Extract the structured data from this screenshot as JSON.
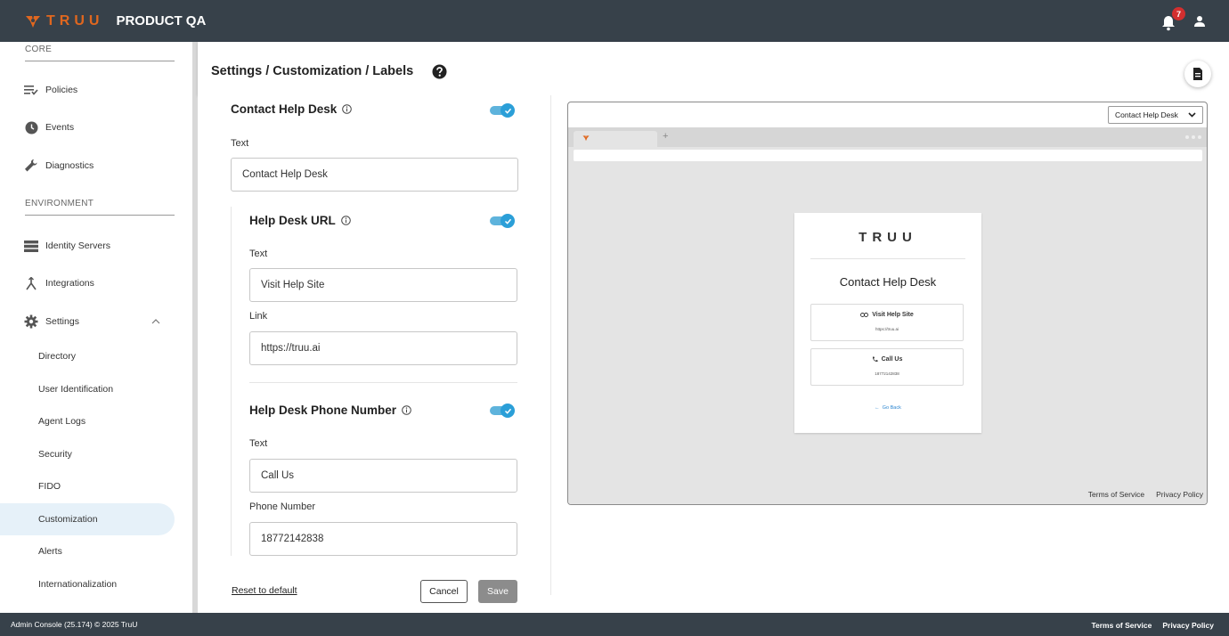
{
  "app": {
    "logo_text": "TRUU",
    "title": "PRODUCT QA",
    "notification_count": "7",
    "brand_color": "#e0671f",
    "topbar_color": "#37414a"
  },
  "sidebar": {
    "section_core": "CORE",
    "section_environment": "ENVIRONMENT",
    "items": {
      "policies": "Policies",
      "events": "Events",
      "diagnostics": "Diagnostics",
      "identity_servers": "Identity Servers",
      "integrations": "Integrations",
      "settings": "Settings"
    },
    "settings_children": {
      "directory": "Directory",
      "user_identification": "User Identification",
      "agent_logs": "Agent Logs",
      "security": "Security",
      "fido": "FIDO",
      "customization": "Customization",
      "alerts": "Alerts",
      "internationalization": "Internationalization"
    },
    "active_item": "Customization"
  },
  "header": {
    "breadcrumb": "Settings / Customization / Labels"
  },
  "form": {
    "contact": {
      "title": "Contact Help Desk",
      "enabled": true,
      "text_label": "Text",
      "text_value": "Contact Help Desk"
    },
    "url": {
      "title": "Help Desk URL",
      "enabled": true,
      "text_label": "Text",
      "text_value": "Visit Help Site",
      "link_label": "Link",
      "link_value": "https://truu.ai"
    },
    "phone": {
      "title": "Help Desk Phone Number",
      "enabled": true,
      "text_label": "Text",
      "text_value": "Call Us",
      "number_label": "Phone Number",
      "number_value": "18772142838"
    },
    "reset_label": "Reset to default",
    "cancel_label": "Cancel",
    "save_label": "Save",
    "accent_color": "#2b9fd8"
  },
  "preview": {
    "selected_screen": "Contact Help Desk",
    "card_logo": "TRUU",
    "card_title": "Contact Help Desk",
    "option1_title": "Visit Help Site",
    "option1_sub": "https://truu.ai",
    "option2_title": "Call Us",
    "option2_sub": "18772142838",
    "go_back": "Go Back",
    "terms": "Terms of Service",
    "privacy": "Privacy Policy"
  },
  "footer": {
    "left": "Admin Console (25.174) © 2025 TruU",
    "terms": "Terms of Service",
    "privacy": "Privacy Policy"
  }
}
